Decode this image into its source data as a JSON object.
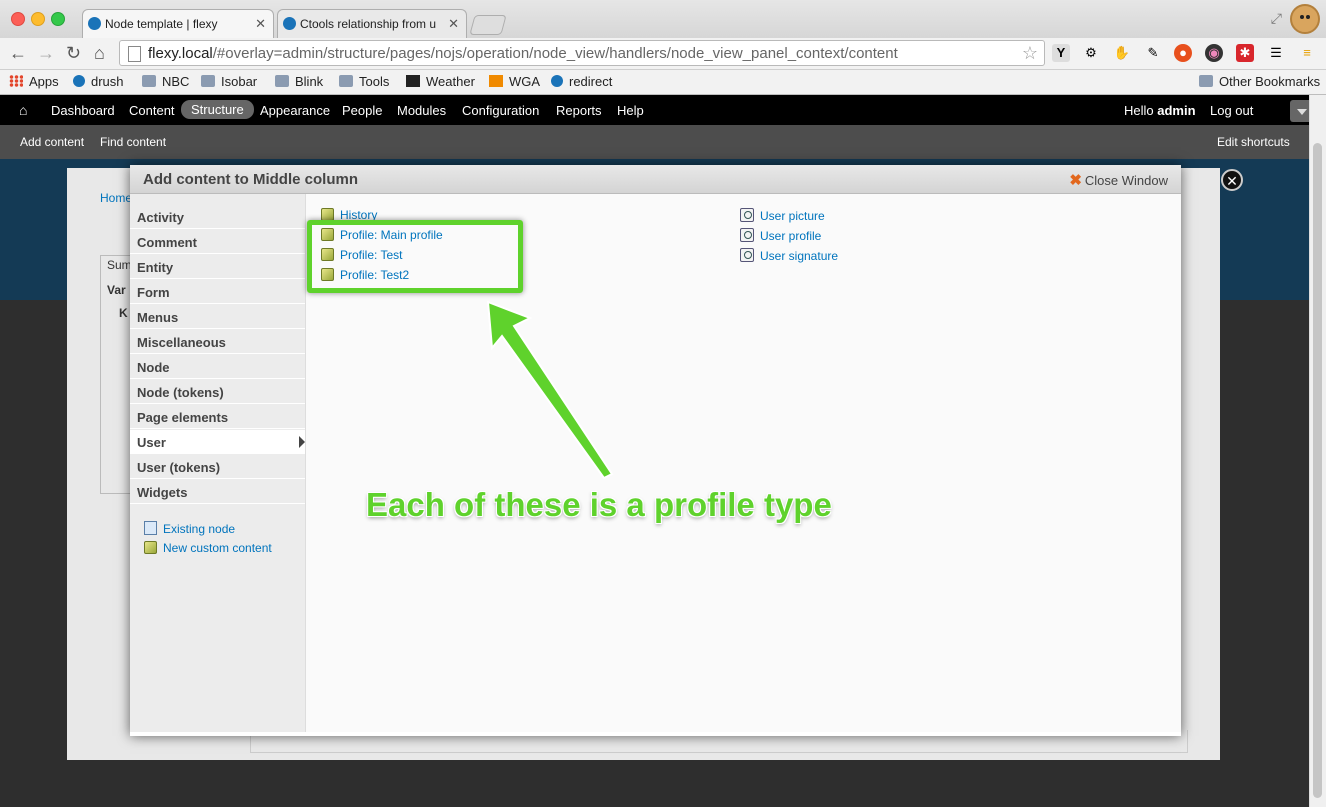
{
  "browser": {
    "tabs": [
      {
        "title": "Node template | flexy",
        "active": true
      },
      {
        "title": "Ctools relationship from u",
        "active": false
      }
    ],
    "url_host": "flexy.local",
    "url_path": "/#overlay=admin/structure/pages/nojs/operation/node_view/handlers/node_view_panel_context/content",
    "bookmarks": [
      "Apps",
      "drush",
      "NBC",
      "Isobar",
      "Blink",
      "Tools",
      "Weather",
      "WGA",
      "redirect"
    ],
    "other_bookmarks": "Other Bookmarks"
  },
  "admin_menu": {
    "items": [
      "Dashboard",
      "Content",
      "Structure",
      "Appearance",
      "People",
      "Modules",
      "Configuration",
      "Reports",
      "Help"
    ],
    "active": "Structure",
    "greeting": "Hello ",
    "user": "admin",
    "logout": "Log out"
  },
  "shortcuts": {
    "items": [
      "Add content",
      "Find content"
    ],
    "edit": "Edit shortcuts"
  },
  "background_page": {
    "home": "Home",
    "fragments": [
      "Sum",
      "Var",
      "K"
    ]
  },
  "modal": {
    "title": "Add content to Middle column",
    "close_label": "Close Window",
    "categories": [
      "Activity",
      "Comment",
      "Entity",
      "Form",
      "Menus",
      "Miscellaneous",
      "Node",
      "Node (tokens)",
      "Page elements",
      "User",
      "User (tokens)",
      "Widgets"
    ],
    "active_category": "User",
    "extras": [
      "Existing node",
      "New custom content"
    ],
    "left_items": [
      "History",
      "Profile: Main profile",
      "Profile: Test",
      "Profile: Test2"
    ],
    "right_items": [
      "User picture",
      "User profile",
      "User signature"
    ]
  },
  "annotation": {
    "text": "Each of these is a profile type",
    "color": "#5fd22c"
  }
}
